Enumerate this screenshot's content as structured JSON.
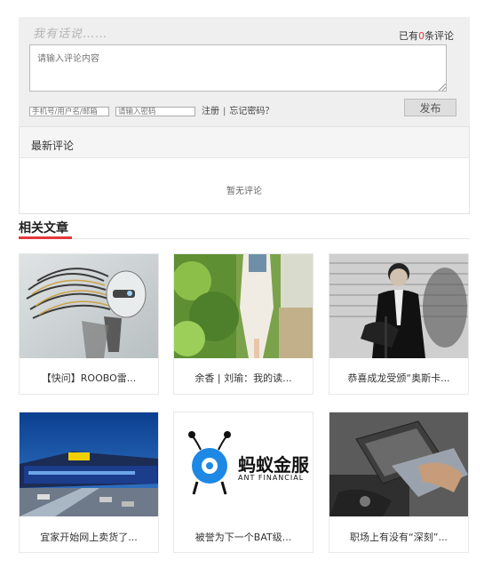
{
  "comment": {
    "say_title": "我有话说……",
    "count_prefix": "已有",
    "count_num": "0",
    "count_suffix": "条评论",
    "textarea_placeholder": "请输入评论内容",
    "user_placeholder": "手机号/用户名/邮箱",
    "password_placeholder": "请输入密码",
    "register_link": "注册",
    "separator": "|",
    "forgot_link": "忘记密码？",
    "publish_label": "发布"
  },
  "latest": {
    "title": "最新评论",
    "empty": "暂无评论"
  },
  "related": {
    "title": "相关文章",
    "accent_color": "#e4393c",
    "articles": [
      {
        "caption": "【快问】ROOBO雷...",
        "image": "robot-head-photo"
      },
      {
        "caption": "余香 | 刘瑜：我的读...",
        "image": "garden-woman-photo"
      },
      {
        "caption": "恭喜成龙受颁“奥斯卡...",
        "image": "jackie-chan-photo"
      },
      {
        "caption": "宜家开始网上卖货了...",
        "image": "ikea-store-photo"
      },
      {
        "caption": "被誉为下一个BAT级...",
        "image": "ant-financial-logo",
        "logo_cn": "蚂蚁金服",
        "logo_en": "ANT FINANCIAL"
      },
      {
        "caption": "职场上有没有“深刻”...",
        "image": "laptop-work-photo"
      }
    ]
  }
}
